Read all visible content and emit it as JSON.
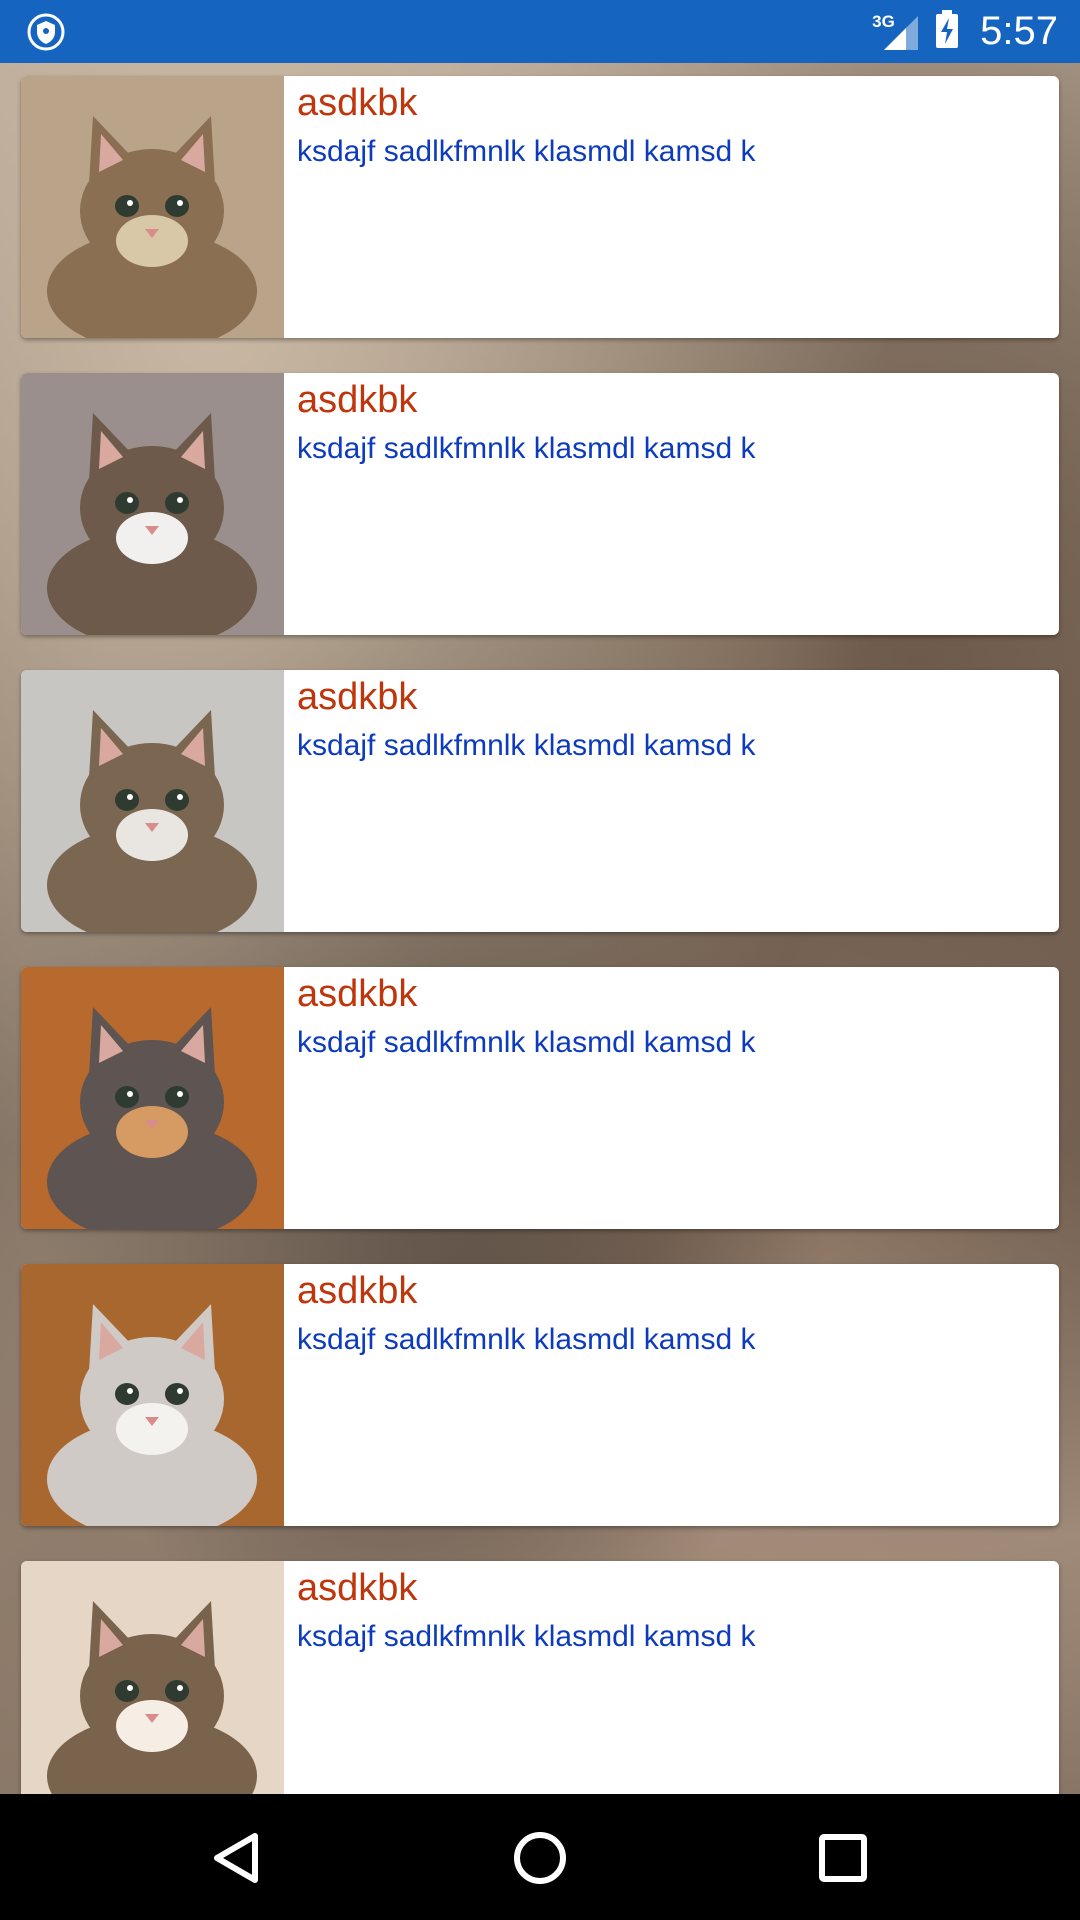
{
  "status_bar": {
    "network": "3G",
    "time": "5:57"
  },
  "cards": [
    {
      "title": "asdkbk",
      "text": "ksdajf sadlkfmnlk klasmdl kamsd k",
      "bg": "#b9a48a",
      "fur": "#8a6f52",
      "accent": "#d8c8a8"
    },
    {
      "title": "asdkbk",
      "text": "ksdajf sadlkfmnlk klasmdl kamsd k",
      "bg": "#9a8f8c",
      "fur": "#6e5a4a",
      "accent": "#f2f0ee"
    },
    {
      "title": "asdkbk",
      "text": "ksdajf sadlkfmnlk klasmdl kamsd k",
      "bg": "#c8c6c2",
      "fur": "#7b6651",
      "accent": "#e9e6e1"
    },
    {
      "title": "asdkbk",
      "text": "ksdajf sadlkfmnlk klasmdl kamsd k",
      "bg": "#b86a2e",
      "fur": "#5e5552",
      "accent": "#d69a63"
    },
    {
      "title": "asdkbk",
      "text": "ksdajf sadlkfmnlk klasmdl kamsd k",
      "bg": "#a8672f",
      "fur": "#cfcac6",
      "accent": "#f4f2ef"
    },
    {
      "title": "asdkbk",
      "text": "ksdajf sadlkfmnlk klasmdl kamsd k",
      "bg": "#e6d6c6",
      "fur": "#7a634c",
      "accent": "#f6ede4"
    }
  ],
  "nav": {
    "back_icon": "back-triangle-icon",
    "home_icon": "home-circle-icon",
    "recents_icon": "recents-square-icon"
  }
}
